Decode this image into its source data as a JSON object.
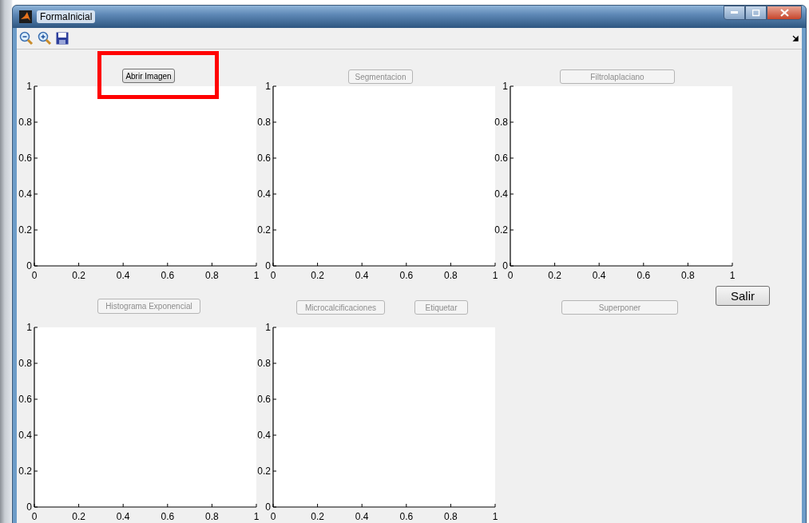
{
  "window": {
    "title": "FormaInicial"
  },
  "toolbar": [
    {
      "kind": "zoom-out"
    },
    {
      "kind": "zoom-in"
    },
    {
      "kind": "save"
    }
  ],
  "buttons": [
    {
      "label": "Abrir Imagen",
      "kind": "small",
      "disabled": false,
      "highlighted": true
    },
    {
      "label": "Segmentacion",
      "kind": "small",
      "disabled": true,
      "highlighted": false
    },
    {
      "label": "Filtrolaplaciano",
      "kind": "small",
      "disabled": true,
      "highlighted": false
    },
    {
      "label": "Histograma Exponencial",
      "kind": "small",
      "disabled": true,
      "highlighted": false
    },
    {
      "label": "Microcalcificaciones",
      "kind": "small",
      "disabled": true,
      "highlighted": false
    },
    {
      "label": "Etiquetar",
      "kind": "small",
      "disabled": true,
      "highlighted": false
    },
    {
      "label": "Superponer",
      "kind": "small",
      "disabled": true,
      "highlighted": false
    },
    {
      "label": "Salir",
      "kind": "large",
      "disabled": false,
      "highlighted": false
    }
  ],
  "axes": [
    {
      "chart_data": {
        "type": "line",
        "xlim": [
          0,
          1
        ],
        "ylim": [
          0,
          1
        ],
        "xticks": [
          0,
          0.2,
          0.4,
          0.6,
          0.8,
          1
        ],
        "yticks": [
          0,
          0.2,
          0.4,
          0.6,
          0.8,
          1
        ]
      }
    },
    {
      "chart_data": {
        "type": "line",
        "xlim": [
          0,
          1
        ],
        "ylim": [
          0,
          1
        ],
        "xticks": [
          0,
          0.2,
          0.4,
          0.6,
          0.8,
          1
        ],
        "yticks": [
          0,
          0.2,
          0.4,
          0.6,
          0.8,
          1
        ]
      }
    },
    {
      "chart_data": {
        "type": "line",
        "xlim": [
          0,
          1
        ],
        "ylim": [
          0,
          1
        ],
        "xticks": [
          0,
          0.2,
          0.4,
          0.6,
          0.8,
          1
        ],
        "yticks": [
          0,
          0.2,
          0.4,
          0.6,
          0.8,
          1
        ]
      }
    },
    {
      "chart_data": {
        "type": "line",
        "xlim": [
          0,
          1
        ],
        "ylim": [
          0,
          1
        ],
        "xticks": [
          0,
          0.2,
          0.4,
          0.6,
          0.8,
          1
        ],
        "yticks": [
          0,
          0.2,
          0.4,
          0.6,
          0.8,
          1
        ]
      }
    },
    {
      "chart_data": {
        "type": "line",
        "xlim": [
          0,
          1
        ],
        "ylim": [
          0,
          1
        ],
        "xticks": [
          0,
          0.2,
          0.4,
          0.6,
          0.8,
          1
        ],
        "yticks": [
          0,
          0.2,
          0.4,
          0.6,
          0.8,
          1
        ]
      }
    }
  ]
}
